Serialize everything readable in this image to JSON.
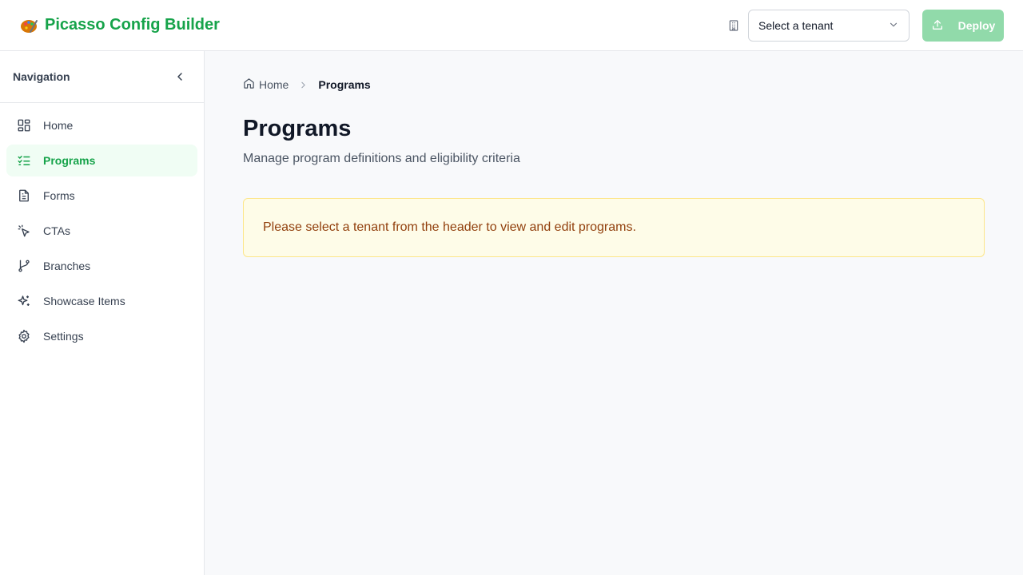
{
  "app": {
    "title": "Picasso Config Builder",
    "logo_icon": "palette-icon",
    "brand_color": "#16a34a"
  },
  "header": {
    "tenant_select": {
      "value": "Select a tenant",
      "icon": "building-icon"
    },
    "deploy_label": "Deploy"
  },
  "sidebar": {
    "title": "Navigation",
    "items": [
      {
        "label": "Home",
        "icon": "dashboard-icon",
        "active": false
      },
      {
        "label": "Programs",
        "icon": "list-check-icon",
        "active": true
      },
      {
        "label": "Forms",
        "icon": "file-text-icon",
        "active": false
      },
      {
        "label": "CTAs",
        "icon": "pointer-click-icon",
        "active": false
      },
      {
        "label": "Branches",
        "icon": "git-branch-icon",
        "active": false
      },
      {
        "label": "Showcase Items",
        "icon": "sparkles-icon",
        "active": false
      },
      {
        "label": "Settings",
        "icon": "gear-icon",
        "active": false
      }
    ]
  },
  "breadcrumb": {
    "home": "Home",
    "current": "Programs"
  },
  "main": {
    "title": "Programs",
    "subtitle": "Manage program definitions and eligibility criteria",
    "notice": "Please select a tenant from the header to view and edit programs.",
    "notice_bg": "#fefce8",
    "notice_text_color": "#92400e"
  }
}
